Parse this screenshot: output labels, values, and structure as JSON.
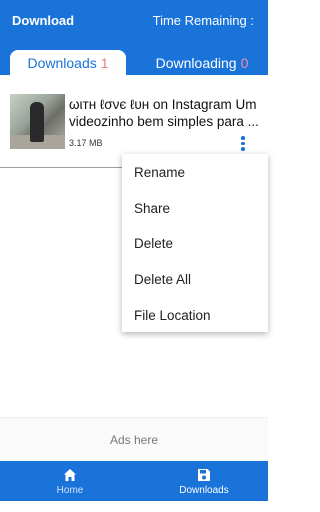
{
  "header": {
    "title": "Download",
    "time_remaining": "Time Remaining :"
  },
  "tabs": [
    {
      "label": "Downloads",
      "count": "1"
    },
    {
      "label": "Downloading",
      "count": "0"
    }
  ],
  "download_item": {
    "title": "ωιтн ℓσνє ℓυн on Instagram Um videozinho bem simples para ...",
    "size": "3.17 MB"
  },
  "menu": {
    "items": [
      "Rename",
      "Share",
      "Delete",
      "Delete All",
      "File Location"
    ]
  },
  "ads": {
    "label": "Ads here"
  },
  "bottom_nav": {
    "home_label": "Home",
    "downloads_label": "Downloads"
  },
  "colors": {
    "primary": "#1a73d9",
    "badge": "#f07a84"
  }
}
